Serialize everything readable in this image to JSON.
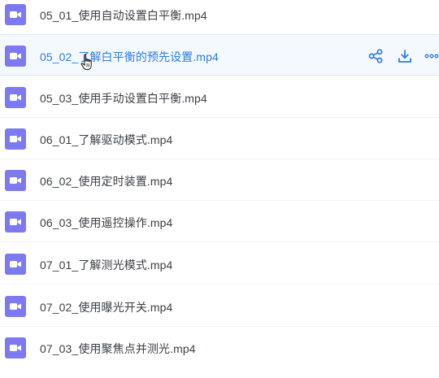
{
  "files": [
    {
      "name": "05_01_使用自动设置白平衡.mp4",
      "icon": "video-file-icon"
    },
    {
      "name": "05_02_了解白平衡的预先设置.mp4",
      "icon": "video-file-icon"
    },
    {
      "name": "05_03_使用手动设置白平衡.mp4",
      "icon": "video-file-icon"
    },
    {
      "name": "06_01_了解驱动模式.mp4",
      "icon": "video-file-icon"
    },
    {
      "name": "06_02_使用定时装置.mp4",
      "icon": "video-file-icon"
    },
    {
      "name": "06_03_使用遥控操作.mp4",
      "icon": "video-file-icon"
    },
    {
      "name": "07_01_了解测光模式.mp4",
      "icon": "video-file-icon"
    },
    {
      "name": "07_02_使用曝光开关.mp4",
      "icon": "video-file-icon"
    },
    {
      "name": "07_03_使用聚焦点并测光.mp4",
      "icon": "video-file-icon"
    }
  ],
  "actions": [
    {
      "icon": "share-icon"
    },
    {
      "icon": "download-icon"
    },
    {
      "icon": "more-icon"
    }
  ],
  "colors": {
    "icon_purple": "#7d79f0",
    "link_blue": "#2e7de0",
    "text": "#3b3f46"
  }
}
